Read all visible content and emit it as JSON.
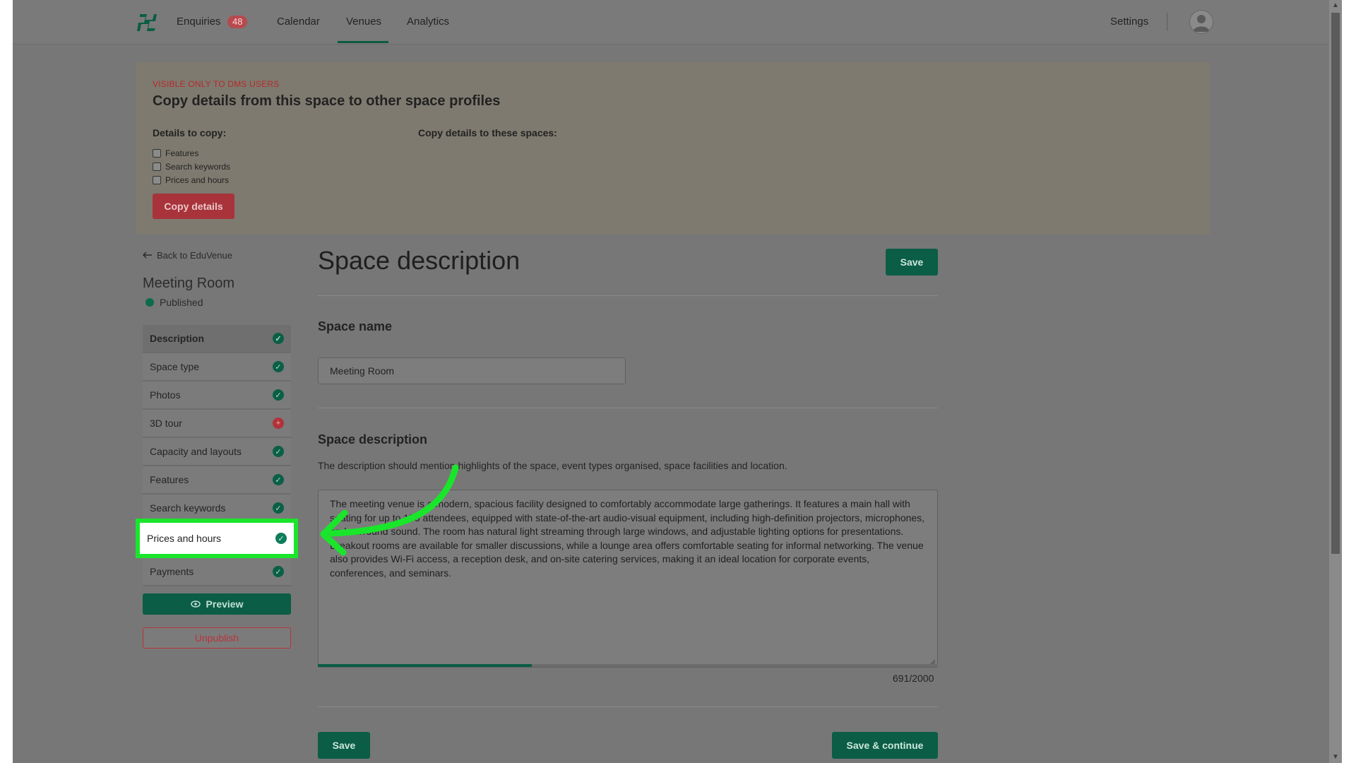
{
  "nav": {
    "items": [
      {
        "label": "Enquiries",
        "badge": "48"
      },
      {
        "label": "Calendar"
      },
      {
        "label": "Venues",
        "active": true
      },
      {
        "label": "Analytics"
      }
    ],
    "settings_label": "Settings"
  },
  "copy_panel": {
    "visible_label": "VISIBLE ONLY TO DMS USERS",
    "title": "Copy details from this space to other space profiles",
    "details_label": "Details to copy:",
    "to_spaces_label": "Copy details to these spaces:",
    "options": [
      "Features",
      "Search keywords",
      "Prices and hours"
    ],
    "copy_button": "Copy details"
  },
  "sidebar": {
    "back_link": "Back to EduVenue",
    "space_title": "Meeting Room",
    "status": "Published",
    "items": [
      {
        "label": "Description",
        "state": "ok"
      },
      {
        "label": "Space type",
        "state": "ok"
      },
      {
        "label": "Photos",
        "state": "ok"
      },
      {
        "label": "3D tour",
        "state": "missing"
      },
      {
        "label": "Capacity and layouts",
        "state": "ok"
      },
      {
        "label": "Features",
        "state": "ok"
      },
      {
        "label": "Search keywords",
        "state": "ok"
      },
      {
        "label": "Prices and hours",
        "state": "ok"
      },
      {
        "label": "Payments",
        "state": "ok"
      }
    ],
    "preview_button": "Preview",
    "unpublish_button": "Unpublish"
  },
  "main": {
    "title": "Space description",
    "save_label": "Save",
    "space_name_heading": "Space name",
    "space_name_value": "Meeting Room",
    "desc_heading": "Space description",
    "desc_help": "The description should mention highlights of the space, event types organised, space facilities and location.",
    "desc_text": "The meeting venue is a modern, spacious facility designed to comfortably accommodate large gatherings. It features a main hall with seating for up to 150 attendees, equipped with state-of-the-art audio-visual equipment, including high-definition projectors, microphones, and surround sound. The room has natural light streaming through large windows, and adjustable lighting options for presentations. Breakout rooms are available for smaller discussions, while a lounge area offers comfortable seating for informal networking. The venue also provides Wi-Fi access, a reception desk, and on-site catering services, making it an ideal location for corporate events, conferences, and seminars.",
    "counter": "691/2000",
    "progress": 0.3455,
    "save_continue_label": "Save & continue"
  },
  "colors": {
    "brand_green": "#0b5d45",
    "alert_red": "#b1323a",
    "highlight": "#19e62a"
  }
}
